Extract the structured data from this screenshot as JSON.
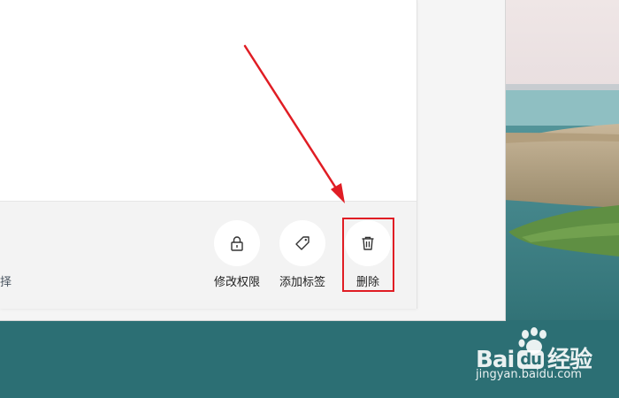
{
  "toolbar": {
    "select_text": "选择",
    "actions": [
      {
        "id": "modify-permission",
        "label": "修改权限",
        "icon": "lock-icon"
      },
      {
        "id": "add-tag",
        "label": "添加标签",
        "icon": "tag-icon"
      },
      {
        "id": "delete",
        "label": "删除",
        "icon": "trash-icon"
      }
    ]
  },
  "highlight_color": "#e01d24",
  "watermark": {
    "brand_left": "Bai",
    "brand_right": "经验",
    "url": "jingyan.baidu.com"
  }
}
